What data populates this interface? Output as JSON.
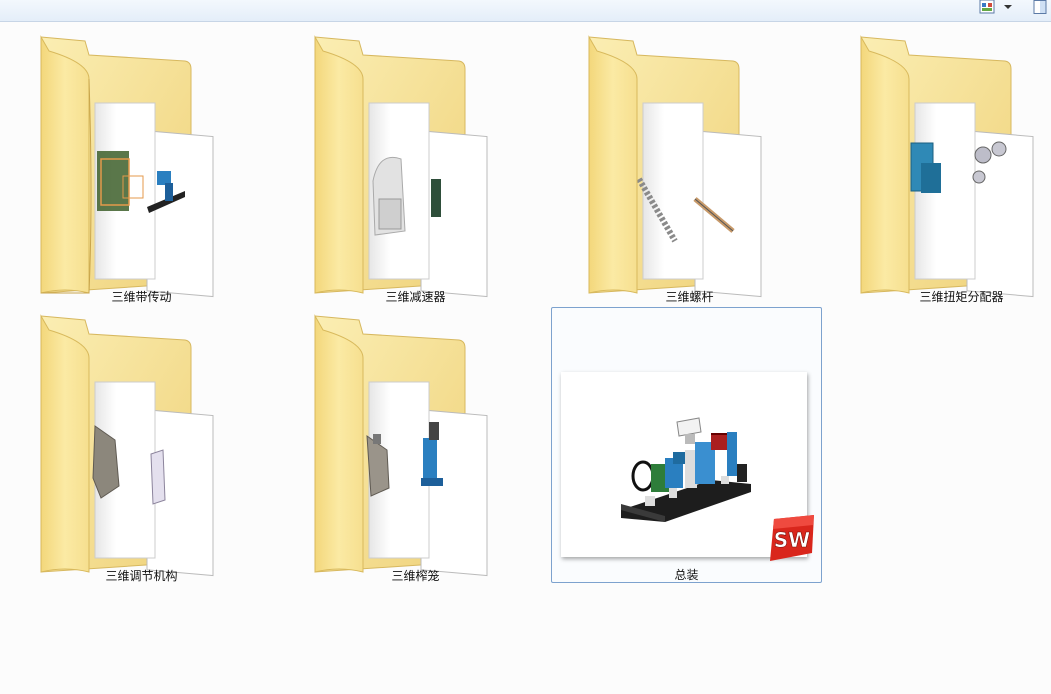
{
  "toolbar": {
    "icons": [
      "change-view-icon",
      "dropdown-arrow-icon",
      "preview-pane-icon"
    ]
  },
  "items": [
    {
      "label": "三维带传动",
      "type": "folder"
    },
    {
      "label": "三维减速器",
      "type": "folder"
    },
    {
      "label": "三维螺杆",
      "type": "folder"
    },
    {
      "label": "三维扭矩分配器",
      "type": "folder"
    },
    {
      "label": "三维调节机构",
      "type": "folder"
    },
    {
      "label": "三维榨笼",
      "type": "folder"
    },
    {
      "label": "总装",
      "type": "solidworks-file",
      "selected": true,
      "badge_text": "SW"
    }
  ],
  "colors": {
    "folder_yellow": "#f5dc84",
    "selection_border": "#7da2ce",
    "sw_red": "#d9261c",
    "machine_blue": "#2a7fc0"
  }
}
